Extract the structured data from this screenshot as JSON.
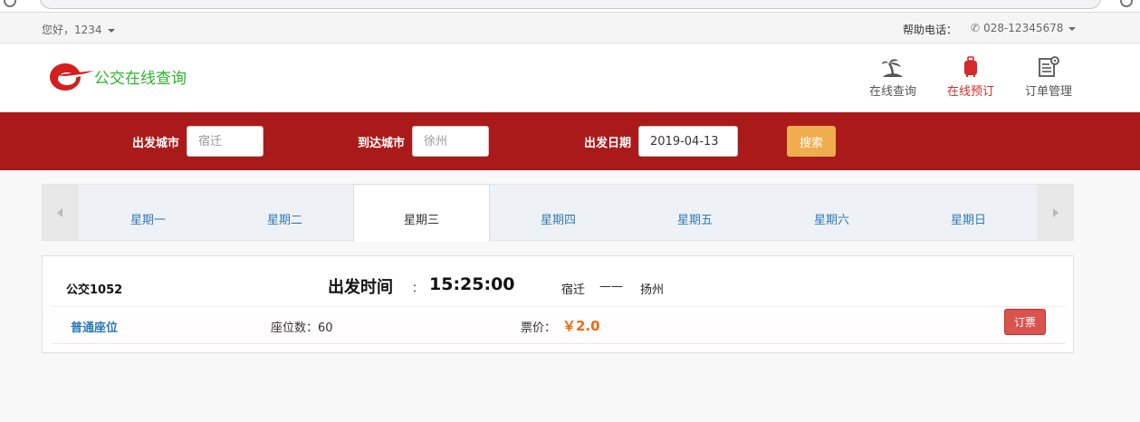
{
  "topbar": {
    "greeting": "您好，1234",
    "help_label": "帮助电话：",
    "phone": "028-12345678"
  },
  "header": {
    "brand": "公交在线查询",
    "nav": [
      {
        "label": "在线查询",
        "icon": "palm-island-icon"
      },
      {
        "label": "在线预订",
        "icon": "luggage-icon",
        "active": true
      },
      {
        "label": "订单管理",
        "icon": "document-settings-icon"
      }
    ]
  },
  "search": {
    "from_label": "出发城市",
    "from_placeholder": "宿迁",
    "to_label": "到达城市",
    "to_placeholder": "徐州",
    "date_label": "出发日期",
    "date_value": "2019-04-13",
    "button_label": "搜索"
  },
  "tabs": [
    "星期一",
    "星期二",
    "星期三",
    "星期四",
    "星期五",
    "星期六",
    "星期日"
  ],
  "active_tab": "星期三",
  "result": {
    "bus_no": "公交1052",
    "departure_label": "出发时间",
    "colon": "：",
    "departure_time": "15:25:00",
    "from": "宿迁",
    "dash": "——",
    "to": "扬州",
    "seat_type": "普通座位",
    "seat_count": "座位数：60",
    "price_label": "票价：",
    "price": "￥2.0",
    "book_label": "订票"
  },
  "colors": {
    "brand_red": "#ab1a1a",
    "brand_green": "#2cb32c",
    "search_button": "#f0ad4e",
    "book_button": "#d9534f",
    "price": "#f06a12",
    "link": "#337ab7"
  }
}
